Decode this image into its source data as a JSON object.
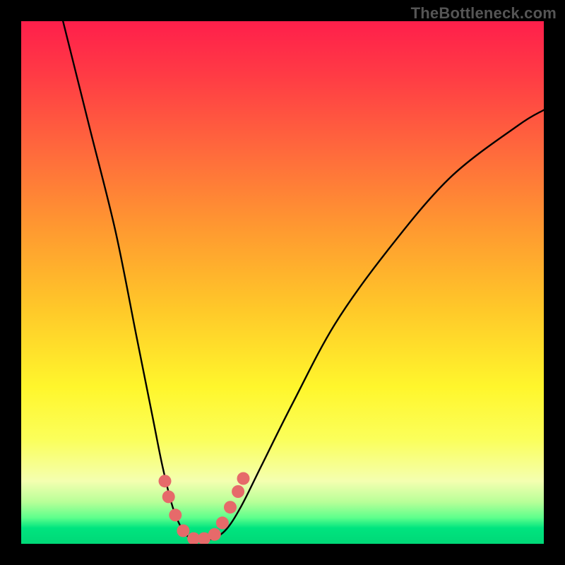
{
  "watermark": "TheBottleneck.com",
  "chart_data": {
    "type": "line",
    "title": "",
    "xlabel": "",
    "ylabel": "",
    "xlim": [
      0,
      100
    ],
    "ylim": [
      0,
      100
    ],
    "note": "V-shaped bottleneck curve rendered over a red-to-green vertical gradient. No axis ticks or numeric labels are shown in the image; curve points below are estimated in percent coordinates (x%, y%) of the plot area, y measured from bottom.",
    "series": [
      {
        "name": "bottleneck-curve",
        "points_xy_percent": [
          [
            8,
            100
          ],
          [
            13,
            80
          ],
          [
            18,
            60
          ],
          [
            22,
            40
          ],
          [
            25,
            25
          ],
          [
            27,
            15
          ],
          [
            29,
            7
          ],
          [
            31,
            2.5
          ],
          [
            33,
            0.8
          ],
          [
            36,
            0.8
          ],
          [
            39,
            2.5
          ],
          [
            42,
            7
          ],
          [
            46,
            15
          ],
          [
            52,
            27
          ],
          [
            60,
            42
          ],
          [
            70,
            56
          ],
          [
            82,
            70
          ],
          [
            95,
            80
          ],
          [
            100,
            83
          ]
        ]
      },
      {
        "name": "highlight-marks",
        "color": "#e66a6a",
        "points_xy_percent": [
          [
            27.5,
            12
          ],
          [
            28.2,
            9
          ],
          [
            29.5,
            5.5
          ],
          [
            31,
            2.5
          ],
          [
            33,
            1
          ],
          [
            35,
            1
          ],
          [
            37,
            1.8
          ],
          [
            38.5,
            4
          ],
          [
            40,
            7
          ],
          [
            41.5,
            10
          ],
          [
            42.5,
            12.5
          ]
        ]
      }
    ],
    "gradient_stops": [
      {
        "pos": 0,
        "color": "#ff1f4b"
      },
      {
        "pos": 25,
        "color": "#ff6a3c"
      },
      {
        "pos": 55,
        "color": "#ffc829"
      },
      {
        "pos": 80,
        "color": "#fbff5a"
      },
      {
        "pos": 95,
        "color": "#5eff8c"
      },
      {
        "pos": 100,
        "color": "#00d877"
      }
    ]
  }
}
